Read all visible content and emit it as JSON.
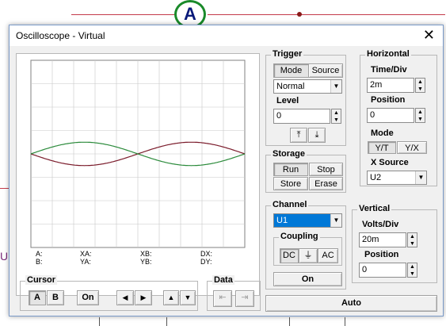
{
  "background": {
    "ammeter_label": "A",
    "left_edge_label": "U"
  },
  "window": {
    "title": "Oscilloscope - Virtual",
    "close_glyph": "✕"
  },
  "trigger": {
    "title": "Trigger",
    "mode_tab": "Mode",
    "source_tab": "Source",
    "mode_value": "Normal",
    "level_label": "Level",
    "level_value": "0",
    "rising_edge_glyph": "⤒",
    "falling_edge_glyph": "⤓"
  },
  "horizontal": {
    "title": "Horizontal",
    "time_div_label": "Time/Div",
    "time_div_value": "2m",
    "position_label": "Position",
    "position_value": "0",
    "mode_label": "Mode",
    "yt_label": "Y/T",
    "yx_label": "Y/X",
    "xsource_label": "X Source",
    "xsource_value": "U2"
  },
  "storage": {
    "title": "Storage",
    "run": "Run",
    "stop": "Stop",
    "store": "Store",
    "erase": "Erase"
  },
  "channel": {
    "title": "Channel",
    "selected": "U1",
    "coupling_title": "Coupling",
    "dc": "DC",
    "gnd_glyph": "⏚",
    "ac": "AC",
    "on_label": "On"
  },
  "vertical": {
    "title": "Vertical",
    "volts_div_label": "Volts/Div",
    "volts_div_value": "20m",
    "position_label": "Position",
    "position_value": "0"
  },
  "auto_label": "Auto",
  "cursor": {
    "title": "Cursor",
    "a": "A",
    "b": "B",
    "on": "On",
    "left_glyph": "◀",
    "right_glyph": "▶",
    "up_glyph": "▲",
    "down_glyph": "▼"
  },
  "data_group": {
    "title": "Data"
  },
  "readouts": {
    "a": "A:",
    "b": "B:",
    "xa": "XA:",
    "ya": "YA:",
    "xb": "XB:",
    "yb": "YB:",
    "dx": "DX:",
    "dy": "DY:"
  },
  "colors": {
    "trace_u1": "#7a1a2a",
    "trace_u2": "#2a8a3a",
    "grid": "#c8c8c8"
  },
  "chart_data": {
    "type": "line",
    "title": "",
    "xlabel": "",
    "ylabel": "",
    "grid": true,
    "grid_divisions": {
      "x": 10,
      "y": 8
    },
    "time_per_div": "2m",
    "volts_per_div": "20m",
    "series": [
      {
        "name": "U1",
        "color": "#7a1a2a",
        "amplitude_div": 0.5,
        "cycles_shown": 1.0,
        "phase_deg": 180
      },
      {
        "name": "U2",
        "color": "#2a8a3a",
        "amplitude_div": 0.5,
        "cycles_shown": 1.0,
        "phase_deg": 0
      }
    ]
  }
}
